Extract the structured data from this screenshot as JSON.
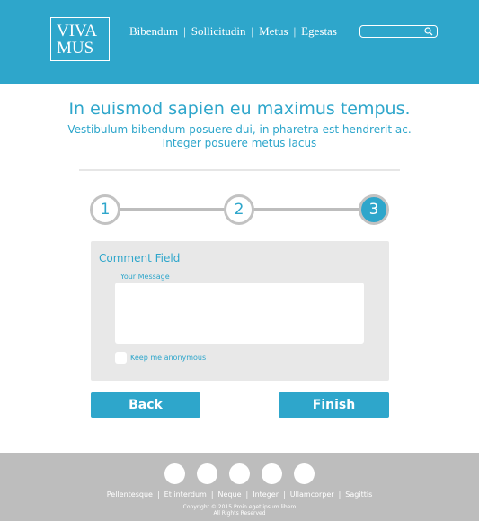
{
  "header": {
    "logo": {
      "line1": "VIVA",
      "line2": "MUS"
    },
    "nav": [
      "Bibendum",
      "Sollicitudin",
      "Metus",
      "Egestas"
    ],
    "nav_separator": "|",
    "search": {
      "placeholder": "",
      "icon": "search-icon"
    }
  },
  "main": {
    "title": "In euismod sapien eu maximus tempus.",
    "subtitle_line1": "Vestibulum bibendum posuere dui, in pharetra est hendrerit ac.",
    "subtitle_line2": "Integer posuere metus lacus"
  },
  "stepper": {
    "steps": [
      "1",
      "2",
      "3"
    ],
    "current_step": 3
  },
  "form": {
    "panel_title": "Comment Field",
    "message_label": "Your Message",
    "message_value": "",
    "anonymous_label": "Keep me anonymous",
    "anonymous_checked": false
  },
  "buttons": {
    "back": "Back",
    "finish": "Finish"
  },
  "footer": {
    "social_icons": [
      "social-icon-1",
      "social-icon-2",
      "social-icon-3",
      "social-icon-4",
      "social-icon-5"
    ],
    "links": [
      "Pellentesque",
      "Et interdum",
      "Neque",
      "Integer",
      "Ullamcorper",
      "Sagittis"
    ],
    "link_separator": "|",
    "copyright_line1": "Copyright © 2015 Proin eget ipsum libero",
    "copyright_line2": "All Rights Reserved"
  },
  "colors": {
    "accent": "#2ea6cb",
    "footer_bg": "#bdbdbd",
    "panel_bg": "#e8e8e8",
    "step_inactive_border": "#c2c2c2"
  }
}
